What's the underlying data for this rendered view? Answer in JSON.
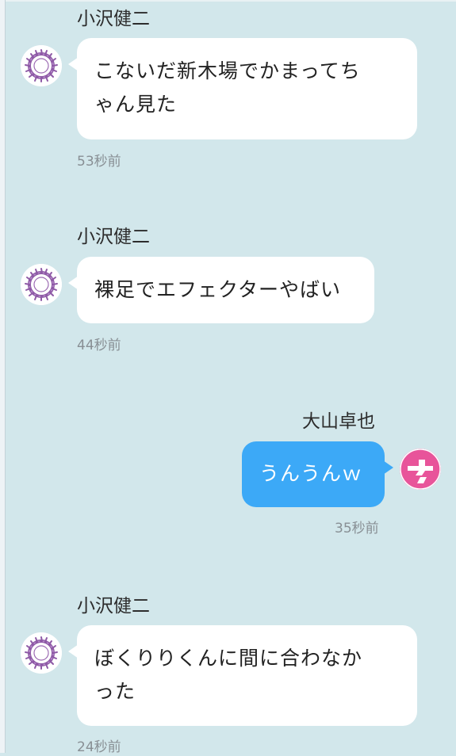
{
  "messages": [
    {
      "sender": "小沢健二",
      "text_lines": [
        "こないだ新木場でかまってち",
        "ゃん見た"
      ],
      "time": "53秒前",
      "direction": "incoming",
      "avatar": "purple-thorn-wreath-icon"
    },
    {
      "sender": "小沢健二",
      "text_lines": [
        "裸足でエフェクターやばい"
      ],
      "time": "44秒前",
      "direction": "incoming",
      "avatar": "purple-thorn-wreath-icon"
    },
    {
      "sender": "大山卓也",
      "text_lines": [
        "うんうんｗ"
      ],
      "time": "35秒前",
      "direction": "outgoing",
      "avatar": "pink-logo-icon"
    },
    {
      "sender": "小沢健二",
      "text_lines": [
        "ぼくりりくんに間に合わなか",
        "った"
      ],
      "time": "24秒前",
      "direction": "incoming",
      "avatar": "purple-thorn-wreath-icon"
    }
  ],
  "colors": {
    "background": "#d2e7eb",
    "incoming_bubble": "#ffffff",
    "outgoing_bubble": "#3ca9f7",
    "avatar_purple": "#8e5aa6",
    "avatar_pink": "#e8549a"
  }
}
